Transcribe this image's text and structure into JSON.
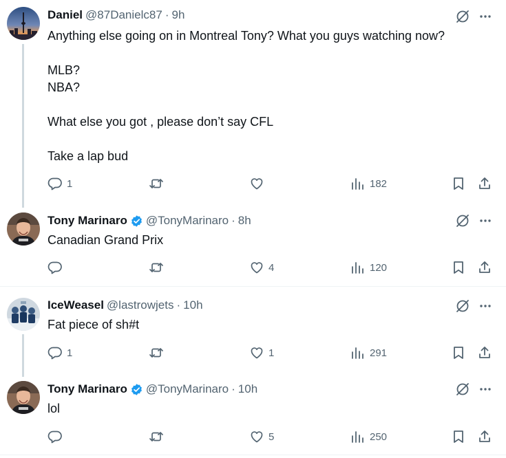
{
  "tweets": [
    {
      "name": "Daniel",
      "handle": "@87Danielc87",
      "dot": "·",
      "time": "9h",
      "verified": false,
      "text": "Anything else going on in Montreal Tony? What you guys watching now?\n\nMLB?\nNBA?\n\nWhat else you got , please don’t say CFL\n\nTake a lap bud",
      "replies": "1",
      "retweets": "",
      "likes": "",
      "views": "182"
    },
    {
      "name": "Tony Marinaro",
      "handle": "@TonyMarinaro",
      "dot": "·",
      "time": "8h",
      "verified": true,
      "text": "Canadian Grand Prix",
      "replies": "",
      "retweets": "",
      "likes": "4",
      "views": "120"
    },
    {
      "name": "IceWeasel",
      "handle": "@lastrowjets",
      "dot": "·",
      "time": "10h",
      "verified": false,
      "text": "Fat piece of sh#t",
      "replies": "1",
      "retweets": "",
      "likes": "1",
      "views": "291"
    },
    {
      "name": "Tony Marinaro",
      "handle": "@TonyMarinaro",
      "dot": "·",
      "time": "10h",
      "verified": true,
      "text": "lol",
      "replies": "",
      "retweets": "",
      "likes": "5",
      "views": "250"
    }
  ],
  "icons": {
    "reply": "reply-icon",
    "retweet": "retweet-icon",
    "like": "like-icon",
    "views": "views-icon",
    "bookmark": "bookmark-icon",
    "share": "share-icon",
    "grok": "grok-icon",
    "more": "more-icon",
    "verified": "verified-badge-icon"
  },
  "colors": {
    "text": "#0f1419",
    "secondary": "#536471",
    "verified": "#1d9bf0",
    "thread_line": "#cfd9de",
    "divider": "#eff3f4"
  }
}
